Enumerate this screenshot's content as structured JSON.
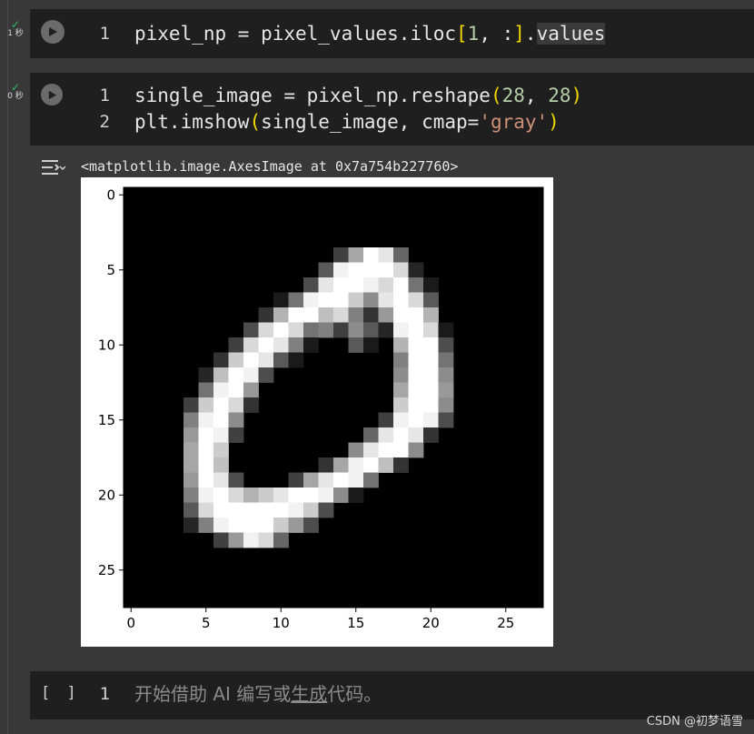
{
  "cells": [
    {
      "status_time": "1 秒",
      "lines": [
        {
          "number": "1",
          "code": "pixel_np = pixel_values.iloc[1, :].values"
        }
      ]
    },
    {
      "status_time": "0 秒",
      "lines": [
        {
          "number": "1",
          "code": "single_image = pixel_np.reshape(28, 28)"
        },
        {
          "number": "2",
          "code": "plt.imshow(single_image, cmap='gray')"
        }
      ],
      "output_text": "<matplotlib.image.AxesImage at 0x7a754b227760>"
    }
  ],
  "empty_cell": {
    "brackets": "[ ]",
    "line_number": "1",
    "placeholder_prefix": "开始借助 AI 编写或",
    "placeholder_link": "生成",
    "placeholder_suffix": "代码。"
  },
  "watermark": "CSDN @初梦语雪",
  "icons": {
    "run": "play-icon",
    "status": "checkmark-icon",
    "output": "output-toggle-icon"
  },
  "colors": {
    "check": "#33b86a",
    "number_token": "#b5cea8",
    "string_token": "#ce9178",
    "bracket_token": "#f1d700"
  },
  "chart_data": {
    "type": "heatmap",
    "colormap": "gray",
    "x_ticks": [
      "0",
      "5",
      "10",
      "15",
      "20",
      "25"
    ],
    "y_ticks": [
      "0",
      "5",
      "10",
      "15",
      "20",
      "25"
    ],
    "xlim": [
      -0.5,
      27.5
    ],
    "ylim": [
      27.5,
      -0.5
    ],
    "matrix_size": [
      28,
      28
    ],
    "pixels_rows": [
      {
        "row": 4,
        "values": [
          [
            14,
            0.25
          ],
          [
            15,
            0.65
          ],
          [
            16,
            1.0
          ],
          [
            17,
            0.9
          ],
          [
            18,
            0.4
          ]
        ]
      },
      {
        "row": 5,
        "values": [
          [
            13,
            0.35
          ],
          [
            14,
            0.95
          ],
          [
            15,
            1.0
          ],
          [
            16,
            1.0
          ],
          [
            17,
            1.0
          ],
          [
            18,
            0.85
          ],
          [
            19,
            0.15
          ]
        ]
      },
      {
        "row": 6,
        "values": [
          [
            12,
            0.3
          ],
          [
            13,
            0.9
          ],
          [
            14,
            1.0
          ],
          [
            15,
            1.0
          ],
          [
            16,
            0.95
          ],
          [
            17,
            0.85
          ],
          [
            18,
            1.0
          ],
          [
            19,
            0.45
          ],
          [
            20,
            0.1
          ]
        ]
      },
      {
        "row": 7,
        "values": [
          [
            10,
            0.1
          ],
          [
            11,
            0.45
          ],
          [
            12,
            0.95
          ],
          [
            13,
            1.0
          ],
          [
            14,
            1.0
          ],
          [
            15,
            0.8
          ],
          [
            16,
            0.55
          ],
          [
            17,
            0.9
          ],
          [
            18,
            1.0
          ],
          [
            19,
            0.85
          ],
          [
            20,
            0.35
          ]
        ]
      },
      {
        "row": 8,
        "values": [
          [
            9,
            0.2
          ],
          [
            10,
            0.7
          ],
          [
            11,
            1.0
          ],
          [
            12,
            1.0
          ],
          [
            13,
            0.75
          ],
          [
            14,
            0.85
          ],
          [
            15,
            0.5
          ],
          [
            16,
            0.2
          ],
          [
            17,
            0.6
          ],
          [
            18,
            1.0
          ],
          [
            19,
            1.0
          ],
          [
            20,
            0.7
          ]
        ]
      },
      {
        "row": 9,
        "values": [
          [
            8,
            0.3
          ],
          [
            9,
            0.85
          ],
          [
            10,
            1.0
          ],
          [
            11,
            0.85
          ],
          [
            12,
            0.45
          ],
          [
            13,
            0.5
          ],
          [
            14,
            0.25
          ],
          [
            15,
            0.55
          ],
          [
            16,
            0.35
          ],
          [
            17,
            0.15
          ],
          [
            18,
            0.95
          ],
          [
            19,
            1.0
          ],
          [
            20,
            0.85
          ],
          [
            21,
            0.1
          ]
        ]
      },
      {
        "row": 10,
        "values": [
          [
            7,
            0.25
          ],
          [
            8,
            0.85
          ],
          [
            9,
            1.0
          ],
          [
            10,
            0.9
          ],
          [
            11,
            0.5
          ],
          [
            12,
            0.1
          ],
          [
            15,
            0.35
          ],
          [
            16,
            0.1
          ],
          [
            18,
            0.7
          ],
          [
            19,
            1.0
          ],
          [
            20,
            1.0
          ],
          [
            21,
            0.3
          ]
        ]
      },
      {
        "row": 11,
        "values": [
          [
            6,
            0.2
          ],
          [
            7,
            0.8
          ],
          [
            8,
            1.0
          ],
          [
            9,
            0.9
          ],
          [
            10,
            0.35
          ],
          [
            11,
            0.1
          ],
          [
            18,
            0.5
          ],
          [
            19,
            1.0
          ],
          [
            20,
            1.0
          ],
          [
            21,
            0.45
          ]
        ]
      },
      {
        "row": 12,
        "values": [
          [
            5,
            0.15
          ],
          [
            6,
            0.75
          ],
          [
            7,
            1.0
          ],
          [
            8,
            0.95
          ],
          [
            9,
            0.3
          ],
          [
            18,
            0.55
          ],
          [
            19,
            1.0
          ],
          [
            20,
            1.0
          ],
          [
            21,
            0.55
          ]
        ]
      },
      {
        "row": 13,
        "values": [
          [
            5,
            0.45
          ],
          [
            6,
            0.95
          ],
          [
            7,
            1.0
          ],
          [
            8,
            0.6
          ],
          [
            18,
            0.65
          ],
          [
            19,
            1.0
          ],
          [
            20,
            1.0
          ],
          [
            21,
            0.6
          ]
        ]
      },
      {
        "row": 14,
        "values": [
          [
            4,
            0.25
          ],
          [
            5,
            0.8
          ],
          [
            6,
            1.0
          ],
          [
            7,
            0.85
          ],
          [
            8,
            0.2
          ],
          [
            18,
            0.8
          ],
          [
            19,
            1.0
          ],
          [
            20,
            1.0
          ],
          [
            21,
            0.55
          ]
        ]
      },
      {
        "row": 15,
        "values": [
          [
            4,
            0.5
          ],
          [
            5,
            0.95
          ],
          [
            6,
            1.0
          ],
          [
            7,
            0.55
          ],
          [
            17,
            0.25
          ],
          [
            18,
            0.95
          ],
          [
            19,
            1.0
          ],
          [
            20,
            0.95
          ],
          [
            21,
            0.3
          ]
        ]
      },
      {
        "row": 16,
        "values": [
          [
            4,
            0.6
          ],
          [
            5,
            1.0
          ],
          [
            6,
            0.95
          ],
          [
            7,
            0.25
          ],
          [
            16,
            0.4
          ],
          [
            17,
            0.9
          ],
          [
            18,
            1.0
          ],
          [
            19,
            0.9
          ],
          [
            20,
            0.2
          ]
        ]
      },
      {
        "row": 17,
        "values": [
          [
            4,
            0.65
          ],
          [
            5,
            1.0
          ],
          [
            6,
            0.8
          ],
          [
            15,
            0.55
          ],
          [
            16,
            0.9
          ],
          [
            17,
            1.0
          ],
          [
            18,
            1.0
          ],
          [
            19,
            0.55
          ]
        ]
      },
      {
        "row": 18,
        "values": [
          [
            4,
            0.65
          ],
          [
            5,
            1.0
          ],
          [
            6,
            0.75
          ],
          [
            13,
            0.2
          ],
          [
            14,
            0.65
          ],
          [
            15,
            0.95
          ],
          [
            16,
            1.0
          ],
          [
            17,
            0.75
          ],
          [
            18,
            0.2
          ]
        ]
      },
      {
        "row": 19,
        "values": [
          [
            4,
            0.6
          ],
          [
            5,
            1.0
          ],
          [
            6,
            0.9
          ],
          [
            7,
            0.3
          ],
          [
            11,
            0.25
          ],
          [
            12,
            0.65
          ],
          [
            13,
            0.9
          ],
          [
            14,
            1.0
          ],
          [
            15,
            0.95
          ],
          [
            16,
            0.45
          ]
        ]
      },
      {
        "row": 20,
        "values": [
          [
            4,
            0.5
          ],
          [
            5,
            0.95
          ],
          [
            6,
            1.0
          ],
          [
            7,
            0.85
          ],
          [
            8,
            0.7
          ],
          [
            9,
            0.8
          ],
          [
            10,
            0.9
          ],
          [
            11,
            1.0
          ],
          [
            12,
            1.0
          ],
          [
            13,
            0.95
          ],
          [
            14,
            0.55
          ],
          [
            15,
            0.1
          ]
        ]
      },
      {
        "row": 21,
        "values": [
          [
            4,
            0.35
          ],
          [
            5,
            0.85
          ],
          [
            6,
            1.0
          ],
          [
            7,
            1.0
          ],
          [
            8,
            1.0
          ],
          [
            9,
            1.0
          ],
          [
            10,
            1.0
          ],
          [
            11,
            0.95
          ],
          [
            12,
            0.8
          ],
          [
            13,
            0.3
          ]
        ]
      },
      {
        "row": 22,
        "values": [
          [
            4,
            0.15
          ],
          [
            5,
            0.5
          ],
          [
            6,
            0.95
          ],
          [
            7,
            1.0
          ],
          [
            8,
            1.0
          ],
          [
            9,
            1.0
          ],
          [
            10,
            0.8
          ],
          [
            11,
            0.6
          ],
          [
            12,
            0.3
          ]
        ]
      },
      {
        "row": 23,
        "values": [
          [
            6,
            0.25
          ],
          [
            7,
            0.6
          ],
          [
            8,
            0.95
          ],
          [
            9,
            0.85
          ],
          [
            10,
            0.4
          ]
        ]
      }
    ]
  }
}
